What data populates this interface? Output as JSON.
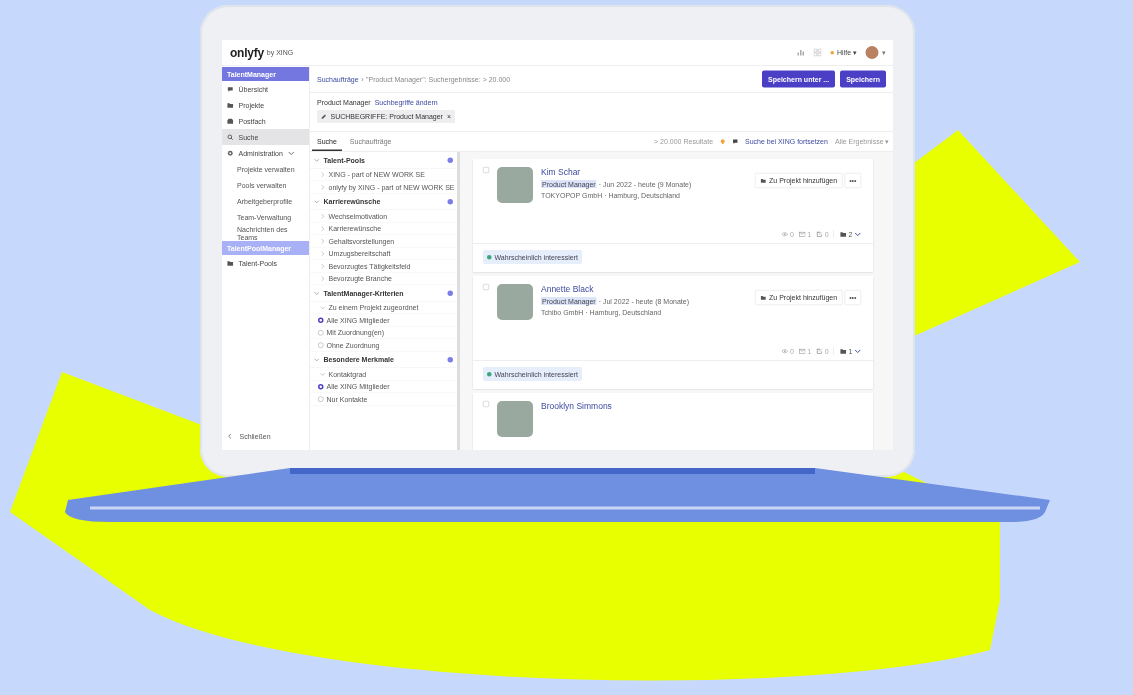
{
  "topbar": {
    "logo": "onlyfy",
    "logo_suffix": "by XING",
    "help": "Hilfe ▾",
    "avatar_caret": "▾"
  },
  "sidebar": {
    "sections": [
      {
        "title": "TalentManager",
        "kind": "primary",
        "items": [
          {
            "label": "Übersicht",
            "selected": false
          },
          {
            "label": "Projekte",
            "selected": false
          },
          {
            "label": "Postfach",
            "selected": false
          },
          {
            "label": "Suche",
            "selected": true
          },
          {
            "label": "Administration",
            "selected": false,
            "expanded": true,
            "children": [
              {
                "label": "Projekte verwalten"
              },
              {
                "label": "Pools verwalten"
              },
              {
                "label": "Arbeitgeberprofile"
              },
              {
                "label": "Team-Verwaltung"
              },
              {
                "label": "Nachrichten des Teams"
              }
            ]
          }
        ]
      },
      {
        "title": "TalentPoolManager",
        "kind": "secondary",
        "items": [
          {
            "label": "Talent-Pools",
            "selected": false
          }
        ]
      }
    ],
    "close": "Schließen"
  },
  "header": {
    "breadcrumb_link": "Suchaufträge",
    "breadcrumb_sep": "›",
    "breadcrumb_rest": "\"Product Manager\": Suchergebnisse: > 20.000",
    "buttons": [
      "Speichern unter ...",
      "Speichern"
    ]
  },
  "search_terms": {
    "title": "Product Manager",
    "link": "Suchbegriffe ändern",
    "chip": "SUCHBEGRIFFE: Product Manager",
    "chip_close": "×"
  },
  "tabs": [
    {
      "label": "Suche",
      "selected": true
    },
    {
      "label": "Suchaufträge",
      "selected": false
    }
  ],
  "results_bar": {
    "count": "> 20.000 Resultate",
    "link": "Suche bei XING fortsetzen",
    "filter": "Alle Ergebnisse ▾"
  },
  "filters": [
    {
      "title": "Talent-Pools",
      "expanded": true,
      "items": [
        {
          "kind": "link",
          "label": "XING - part of NEW WORK SE"
        },
        {
          "kind": "link",
          "label": "onlyfy by XING - part of NEW WORK SE"
        }
      ]
    },
    {
      "title": "Karrierewünsche",
      "expanded": true,
      "items": [
        {
          "kind": "link",
          "label": "Wechselmotivation"
        },
        {
          "kind": "link",
          "label": "Karrierewünsche"
        },
        {
          "kind": "link",
          "label": "Gehaltsvorstellungen"
        },
        {
          "kind": "link",
          "label": "Umzugsbereitschaft"
        },
        {
          "kind": "link",
          "label": "Bevorzugtes Tätigkeitsfeld"
        },
        {
          "kind": "link",
          "label": "Bevorzugte Branche"
        }
      ]
    },
    {
      "title": "TalentManager-Kriterien",
      "expanded": true,
      "items": [
        {
          "kind": "subheading",
          "label": "Zu einem Projekt zugeordnet"
        },
        {
          "kind": "radio",
          "label": "Alle XING Mitglieder",
          "selected": true
        },
        {
          "kind": "radio",
          "label": "Mit Zuordnung(en)",
          "selected": false
        },
        {
          "kind": "radio",
          "label": "Ohne Zuordnung",
          "selected": false
        }
      ]
    },
    {
      "title": "Besondere Merkmale",
      "expanded": true,
      "items": [
        {
          "kind": "subheading",
          "label": "Kontaktgrad"
        },
        {
          "kind": "radio",
          "label": "Alle XING Mitglieder",
          "selected": true
        },
        {
          "kind": "radio",
          "label": "Nur Kontakte",
          "selected": false
        }
      ]
    }
  ],
  "candidates": [
    {
      "name": "Kim Schar",
      "checked": false,
      "role": "Product Manager",
      "period": "· Jun 2022 - heute (9 Monate)",
      "company": "TOKYOPOP GmbH · Hamburg, Deutschland",
      "add_button": "Zu Projekt hinzufügen",
      "more": "•••",
      "stats": [
        {
          "kind": "views",
          "value": "0"
        },
        {
          "kind": "messages",
          "value": "1"
        },
        {
          "kind": "notes",
          "value": "0"
        }
      ],
      "folders": "2",
      "tag": "Wahrscheinlich interessiert"
    },
    {
      "name": "Annette Black",
      "checked": false,
      "role": "Product Manager",
      "period": "· Jul 2022 - heute (8 Monate)",
      "company": "Tchibo GmbH · Hamburg, Deutschland",
      "add_button": "Zu Projekt hinzufügen",
      "more": "•••",
      "stats": [
        {
          "kind": "views",
          "value": "0"
        },
        {
          "kind": "messages",
          "value": "1"
        },
        {
          "kind": "notes",
          "value": "0"
        }
      ],
      "folders": "1",
      "tag": "Wahrscheinlich interessiert"
    },
    {
      "name": "Brooklyn Simmons",
      "checked": false
    }
  ]
}
